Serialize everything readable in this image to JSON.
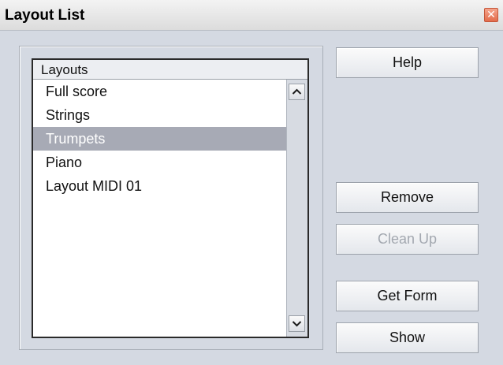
{
  "window": {
    "title": "Layout List",
    "close_glyph": "✕"
  },
  "list": {
    "header": "Layouts",
    "items": [
      {
        "label": "Full score",
        "selected": false
      },
      {
        "label": "Strings",
        "selected": false
      },
      {
        "label": "Trumpets",
        "selected": true
      },
      {
        "label": "Piano",
        "selected": false
      },
      {
        "label": "Layout MIDI 01",
        "selected": false
      }
    ]
  },
  "buttons": {
    "help": "Help",
    "remove": "Remove",
    "clean_up": "Clean Up",
    "get_form": "Get Form",
    "show": "Show"
  },
  "icons": {
    "scroll_up": "chevron-up-icon",
    "scroll_down": "chevron-down-icon",
    "close": "close-icon"
  },
  "colors": {
    "selection": "#a7aab5",
    "disabled_text": "#a3a8b0",
    "close_button": "#e36c4b"
  }
}
